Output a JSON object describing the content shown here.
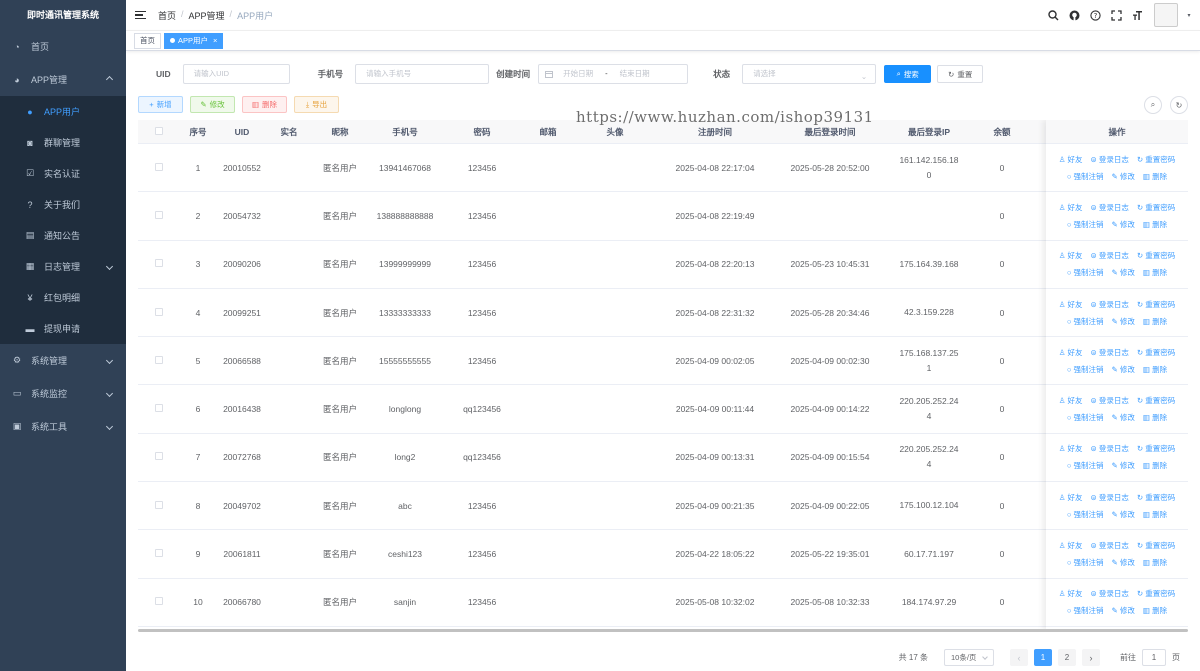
{
  "app_title": "即时通讯管理系统",
  "sidebar": [
    {
      "label": "首页",
      "icon": "dashboard-icon",
      "type": "top"
    },
    {
      "label": "APP管理",
      "icon": "globe-icon",
      "type": "open"
    },
    {
      "label": "APP用户",
      "icon": "user-icon",
      "type": "sub-active"
    },
    {
      "label": "群聊管理",
      "icon": "group-icon",
      "type": "sub"
    },
    {
      "label": "实名认证",
      "icon": "check-square-icon",
      "type": "sub"
    },
    {
      "label": "关于我们",
      "icon": "question-icon",
      "type": "sub"
    },
    {
      "label": "通知公告",
      "icon": "message-icon",
      "type": "sub"
    },
    {
      "label": "日志管理",
      "icon": "log-icon",
      "type": "sub-arrow"
    },
    {
      "label": "红包明细",
      "icon": "yuan-icon",
      "type": "sub"
    },
    {
      "label": "提现申请",
      "icon": "wallet-icon",
      "type": "sub"
    },
    {
      "label": "系统管理",
      "icon": "gear-icon",
      "type": "arrow"
    },
    {
      "label": "系统监控",
      "icon": "monitor-icon",
      "type": "arrow"
    },
    {
      "label": "系统工具",
      "icon": "toolbox-icon",
      "type": "arrow"
    }
  ],
  "breadcrumb": [
    "首页",
    "APP管理",
    "APP用户"
  ],
  "tags": [
    {
      "label": "首页",
      "active": false
    },
    {
      "label": "APP用户",
      "active": true
    }
  ],
  "search": {
    "uid_label": "UID",
    "uid_placeholder": "请输入UID",
    "phone_label": "手机号",
    "phone_placeholder": "请输入手机号",
    "created_label": "创建时间",
    "start_placeholder": "开始日期",
    "range_sep": "-",
    "end_placeholder": "结束日期",
    "status_label": "状态",
    "status_placeholder": "请选择",
    "search_btn": "搜索",
    "reset_btn": "重置"
  },
  "toolbar": {
    "add": "新增",
    "edit": "修改",
    "delete": "删除",
    "export": "导出"
  },
  "watermark": "https://www.huzhan.com/ishop39131",
  "columns": [
    "序号",
    "UID",
    "实名",
    "昵称",
    "手机号",
    "密码",
    "邮箱",
    "头像",
    "注册时间",
    "最后登录时间",
    "最后登录IP",
    "余额"
  ],
  "ops_header": "操作",
  "ops": {
    "friend": "好友",
    "login_log": "登录日志",
    "reset_pwd": "重置密码",
    "force_cancel": "强制注销",
    "edit": "修改",
    "delete": "删除"
  },
  "rows": [
    {
      "no": "1",
      "uid": "20010552",
      "real": "",
      "nick": "匿名用户",
      "phone": "13941467068",
      "pwd": "123456",
      "email": "",
      "avatar": "",
      "reg": "2025-04-08 22:17:04",
      "last": "2025-05-28 20:52:00",
      "ip": "161.142.156.18",
      "ip2": "0",
      "bal": "0"
    },
    {
      "no": "2",
      "uid": "20054732",
      "real": "",
      "nick": "匿名用户",
      "phone": "138888888888",
      "pwd": "123456",
      "email": "",
      "avatar": "",
      "reg": "2025-04-08 22:19:49",
      "last": "",
      "ip": "",
      "ip2": "",
      "bal": "0"
    },
    {
      "no": "3",
      "uid": "20090206",
      "real": "",
      "nick": "匿名用户",
      "phone": "13999999999",
      "pwd": "123456",
      "email": "",
      "avatar": "",
      "reg": "2025-04-08 22:20:13",
      "last": "2025-05-23 10:45:31",
      "ip": "175.164.39.168",
      "ip2": "",
      "bal": "0"
    },
    {
      "no": "4",
      "uid": "20099251",
      "real": "",
      "nick": "匿名用户",
      "phone": "13333333333",
      "pwd": "123456",
      "email": "",
      "avatar": "",
      "reg": "2025-04-08 22:31:32",
      "last": "2025-05-28 20:34:46",
      "ip": "42.3.159.228",
      "ip2": "",
      "bal": "0"
    },
    {
      "no": "5",
      "uid": "20066588",
      "real": "",
      "nick": "匿名用户",
      "phone": "15555555555",
      "pwd": "123456",
      "email": "",
      "avatar": "",
      "reg": "2025-04-09 00:02:05",
      "last": "2025-04-09 00:02:30",
      "ip": "175.168.137.25",
      "ip2": "1",
      "bal": "0"
    },
    {
      "no": "6",
      "uid": "20016438",
      "real": "",
      "nick": "匿名用户",
      "phone": "longlong",
      "pwd": "qq123456",
      "email": "",
      "avatar": "",
      "reg": "2025-04-09 00:11:44",
      "last": "2025-04-09 00:14:22",
      "ip": "220.205.252.24",
      "ip2": "4",
      "bal": "0"
    },
    {
      "no": "7",
      "uid": "20072768",
      "real": "",
      "nick": "匿名用户",
      "phone": "long2",
      "pwd": "qq123456",
      "email": "",
      "avatar": "",
      "reg": "2025-04-09 00:13:31",
      "last": "2025-04-09 00:15:54",
      "ip": "220.205.252.24",
      "ip2": "4",
      "bal": "0"
    },
    {
      "no": "8",
      "uid": "20049702",
      "real": "",
      "nick": "匿名用户",
      "phone": "abc",
      "pwd": "123456",
      "email": "",
      "avatar": "",
      "reg": "2025-04-09 00:21:35",
      "last": "2025-04-09 00:22:05",
      "ip": "175.100.12.104",
      "ip2": "",
      "bal": "0"
    },
    {
      "no": "9",
      "uid": "20061811",
      "real": "",
      "nick": "匿名用户",
      "phone": "ceshi123",
      "pwd": "123456",
      "email": "",
      "avatar": "",
      "reg": "2025-04-22 18:05:22",
      "last": "2025-05-22 19:35:01",
      "ip": "60.17.71.197",
      "ip2": "",
      "bal": "0"
    },
    {
      "no": "10",
      "uid": "20066780",
      "real": "",
      "nick": "匿名用户",
      "phone": "sanjin",
      "pwd": "123456",
      "email": "",
      "avatar": "",
      "reg": "2025-05-08 10:32:02",
      "last": "2025-05-08 10:32:33",
      "ip": "184.174.97.29",
      "ip2": "",
      "bal": "0"
    }
  ],
  "pager": {
    "total": "共 17 条",
    "size": "10条/页",
    "pages": [
      "1",
      "2"
    ],
    "current": "1",
    "goto": "前往",
    "goto_val": "1",
    "goto_unit": "页"
  }
}
